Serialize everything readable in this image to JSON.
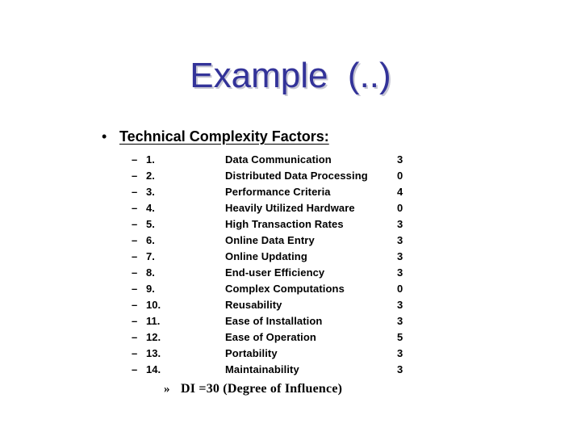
{
  "slide": {
    "title": "Example  (..)",
    "title_color": "#333399",
    "background_color": "#ffffff",
    "text_color": "#000000"
  },
  "heading": {
    "bullet": "•",
    "text": "Technical Complexity Factors:"
  },
  "list": {
    "dash_marker": "–",
    "items": [
      {
        "number": "1.",
        "name": "Data Communication",
        "value": "3"
      },
      {
        "number": "2.",
        "name": "Distributed Data Processing",
        "value": "0"
      },
      {
        "number": "3.",
        "name": "Performance Criteria",
        "value": "4"
      },
      {
        "number": "4.",
        "name": "Heavily Utilized Hardware",
        "value": "0"
      },
      {
        "number": "5.",
        "name": "High Transaction Rates",
        "value": "3"
      },
      {
        "number": "6.",
        "name": "Online Data Entry",
        "value": "3"
      },
      {
        "number": "7.",
        "name": "Online Updating",
        "value": "3"
      },
      {
        "number": "8.",
        "name": "End-user Efficiency",
        "value": "3"
      },
      {
        "number": "9.",
        "name": "Complex Computations",
        "value": "0"
      },
      {
        "number": "10.",
        "name": "Reusability",
        "value": "3"
      },
      {
        "number": "11.",
        "name": "Ease of Installation",
        "value": "3"
      },
      {
        "number": "12.",
        "name": "Ease of Operation",
        "value": "5"
      },
      {
        "number": "13.",
        "name": "Portability",
        "value": "3"
      },
      {
        "number": "14.",
        "name": "Maintainability",
        "value": "3"
      }
    ]
  },
  "footer": {
    "bullet": "»",
    "text": "DI =30 (Degree of Influence)"
  }
}
